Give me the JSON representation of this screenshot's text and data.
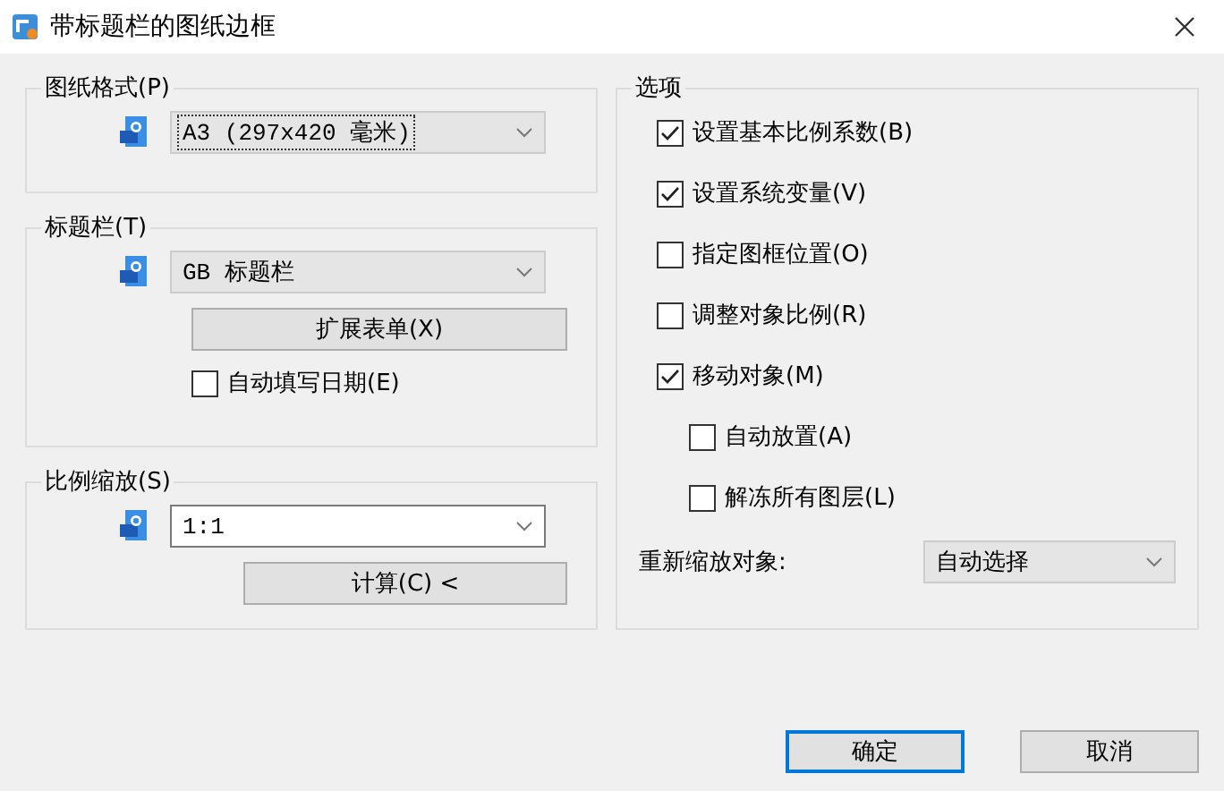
{
  "window": {
    "title": "带标题栏的图纸边框"
  },
  "paper_format": {
    "title": "图纸格式(P)",
    "combo": {
      "kind": "dropdown",
      "value": "A3 (297x420 毫米)",
      "focused": true
    }
  },
  "title_block": {
    "title": "标题栏(T)",
    "combo": {
      "kind": "dropdown",
      "value": "GB 标题栏",
      "focused": false
    },
    "button": "扩展表单(X)",
    "auto_date": {
      "label": "自动填写日期(E)",
      "checked": false
    }
  },
  "scale": {
    "title": "比例缩放(S)",
    "combo": {
      "kind": "editable",
      "value": "1:1",
      "focused": false
    },
    "button": "计算(C) <"
  },
  "options": {
    "title": "选项",
    "items": [
      {
        "label": "设置基本比例系数(B)",
        "checked": true
      },
      {
        "label": "设置系统变量(V)",
        "checked": true
      },
      {
        "label": "指定图框位置(O)",
        "checked": false
      },
      {
        "label": "调整对象比例(R)",
        "checked": false
      },
      {
        "label": "移动对象(M)",
        "checked": true,
        "children": [
          {
            "label": "自动放置(A)",
            "checked": false
          },
          {
            "label": "解冻所有图层(L)",
            "checked": false
          }
        ]
      }
    ],
    "rescale": {
      "label": "重新缩放对象:",
      "combo": {
        "kind": "dropdown",
        "value": "自动选择",
        "focused": false
      }
    }
  },
  "buttons": [
    {
      "label": "确定",
      "default": true
    },
    {
      "label": "取消",
      "default": false
    }
  ]
}
